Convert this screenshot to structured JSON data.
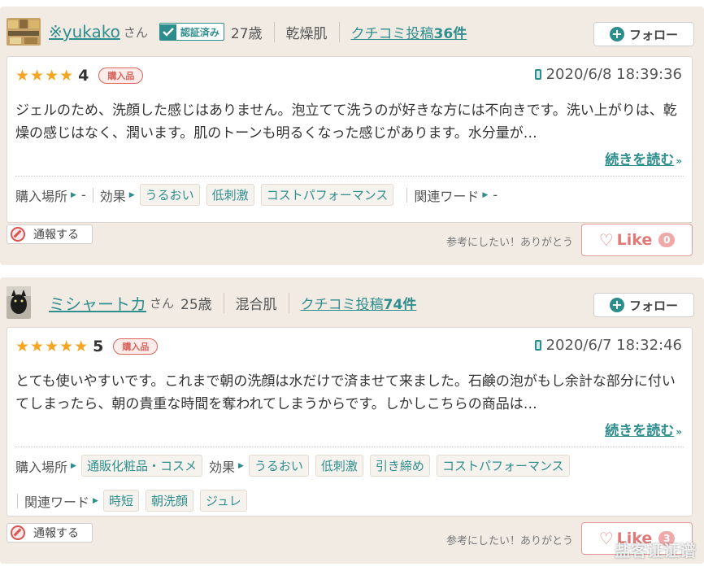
{
  "reviews": [
    {
      "user": {
        "name": "※yukako",
        "honorific": "さん",
        "verified": "認証済み",
        "age": "27歳",
        "skin": "乾燥肌",
        "posts_prefix": "クチコミ投稿",
        "posts_count": "36件"
      },
      "follow_label": "フォロー",
      "stars": "★★★★",
      "score": "4",
      "purchased": "購入品",
      "date": "2020/6/8 18:39:36",
      "body": "ジェルのため、洗顔した感じはありません。泡立てて洗うのが好きな方には不向きです。洗い上がりは、乾燥の感じはなく、潤います。肌のトーンも明るくなった感じがあります。水分量が…",
      "read_more": "続きを読む",
      "meta": {
        "place_label": "購入場所",
        "place_value": "-",
        "effect_label": "効果",
        "effects": [
          "うるおい",
          "低刺激",
          "コストパフォーマンス"
        ],
        "keyword_label": "関連ワード",
        "keyword_value": "-"
      },
      "report_label": "通報する",
      "helpful_text": "参考にしたい！ありがとう",
      "like_label": "Like",
      "like_count": "0"
    },
    {
      "user": {
        "name": "ミシャートカ",
        "honorific": "さん",
        "age": "25歳",
        "skin": "混合肌",
        "posts_prefix": "クチコミ投稿",
        "posts_count": "74件"
      },
      "follow_label": "フォロー",
      "stars": "★★★★★",
      "score": "5",
      "purchased": "購入品",
      "date": "2020/6/7 18:32:46",
      "body": "とても使いやすいです。これまで朝の洗顔は水だけで済ませて来ました。石鹸の泡がもし余計な部分に付いてしまったら、朝の貴重な時間を奪われてしまうからです。しかしこちらの商品は…",
      "read_more": "続きを読む",
      "meta": {
        "place_label": "購入場所",
        "places": [
          "通販化粧品・コスメ"
        ],
        "effect_label": "効果",
        "effects": [
          "うるおい",
          "低刺激",
          "引き締め",
          "コストパフォーマンス"
        ],
        "keyword_label": "関連ワード",
        "keywords": [
          "時短",
          "朝洗顔",
          "ジュレ"
        ]
      },
      "report_label": "通報する",
      "helpful_text": "参考にしたい！ありがとう",
      "like_label": "Like",
      "like_count": "3"
    }
  ],
  "watermark": "盐客证证谱"
}
